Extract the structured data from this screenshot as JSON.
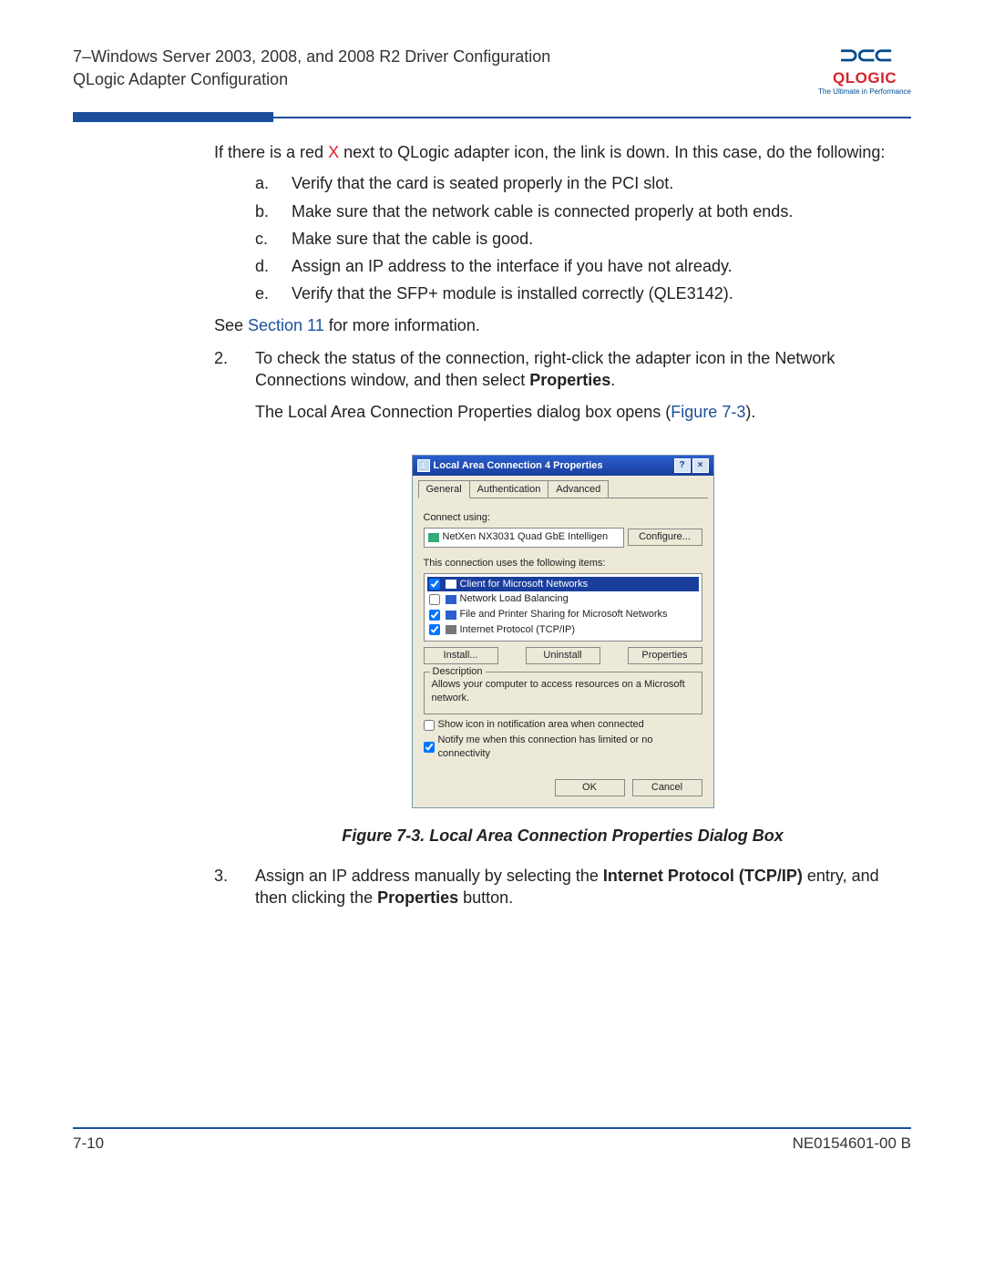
{
  "header": {
    "line1": "7–Windows Server 2003, 2008, and 2008 R2 Driver Configuration",
    "line2": "QLogic Adapter Configuration"
  },
  "logo": {
    "glyph": "⊃⊂⊂",
    "brand": "QLOGIC",
    "tag": "The Ultimate in Performance"
  },
  "intro": {
    "pre": "If there is a red ",
    "x": "X",
    "post": " next to QLogic adapter icon, the link is down. In this case, do the following:"
  },
  "letters": {
    "a": {
      "l": "a.",
      "t": "Verify that the card is seated properly in the PCI slot."
    },
    "b": {
      "l": "b.",
      "t": "Make sure that the network cable is connected properly at both ends."
    },
    "c": {
      "l": "c.",
      "t": "Make sure that the cable is good."
    },
    "d": {
      "l": "d.",
      "t": "Assign an IP address to the interface if you have not already."
    },
    "e": {
      "l": "e.",
      "t": "Verify that the SFP+ module is installed correctly (QLE3142)."
    }
  },
  "see": {
    "pre": "See ",
    "link": "Section 11",
    "post": " for more information."
  },
  "step2": {
    "num": "2.",
    "line1_pre": "To check the status of the connection, right-click the adapter icon in the Network Connections window, and then select ",
    "line1_bold": "Properties",
    "line1_post": ".",
    "line2_pre": "The Local Area Connection Properties dialog box opens (",
    "line2_link": "Figure 7-3",
    "line2_post": ")."
  },
  "dialog": {
    "title": "Local Area Connection 4 Properties",
    "help": "?",
    "close": "×",
    "tabs": {
      "general": "General",
      "auth": "Authentication",
      "adv": "Advanced"
    },
    "connect_using": "Connect using:",
    "adapter": "NetXen NX3031 Quad GbE Intelligen",
    "configure": "Configure...",
    "uses": "This connection uses the following items:",
    "items": {
      "i1": "Client for Microsoft Networks",
      "i2": "Network Load Balancing",
      "i3": "File and Printer Sharing for Microsoft Networks",
      "i4": "Internet Protocol (TCP/IP)"
    },
    "install": "Install...",
    "uninstall": "Uninstall",
    "properties": "Properties",
    "desc_label": "Description",
    "desc_text": "Allows your computer to access resources on a Microsoft network.",
    "chk1": "Show icon in notification area when connected",
    "chk2": "Notify me when this connection has limited or no connectivity",
    "ok": "OK",
    "cancel": "Cancel"
  },
  "figure_caption": "Figure 7-3.  Local Area Connection Properties Dialog Box",
  "step3": {
    "num": "3.",
    "pre": "Assign an IP address manually by selecting the ",
    "bold1": "Internet Protocol (TCP/IP)",
    "mid": " entry, and then clicking the ",
    "bold2": "Properties",
    "post": " button."
  },
  "footer": {
    "left": "7-10",
    "right": "NE0154601-00  B"
  }
}
